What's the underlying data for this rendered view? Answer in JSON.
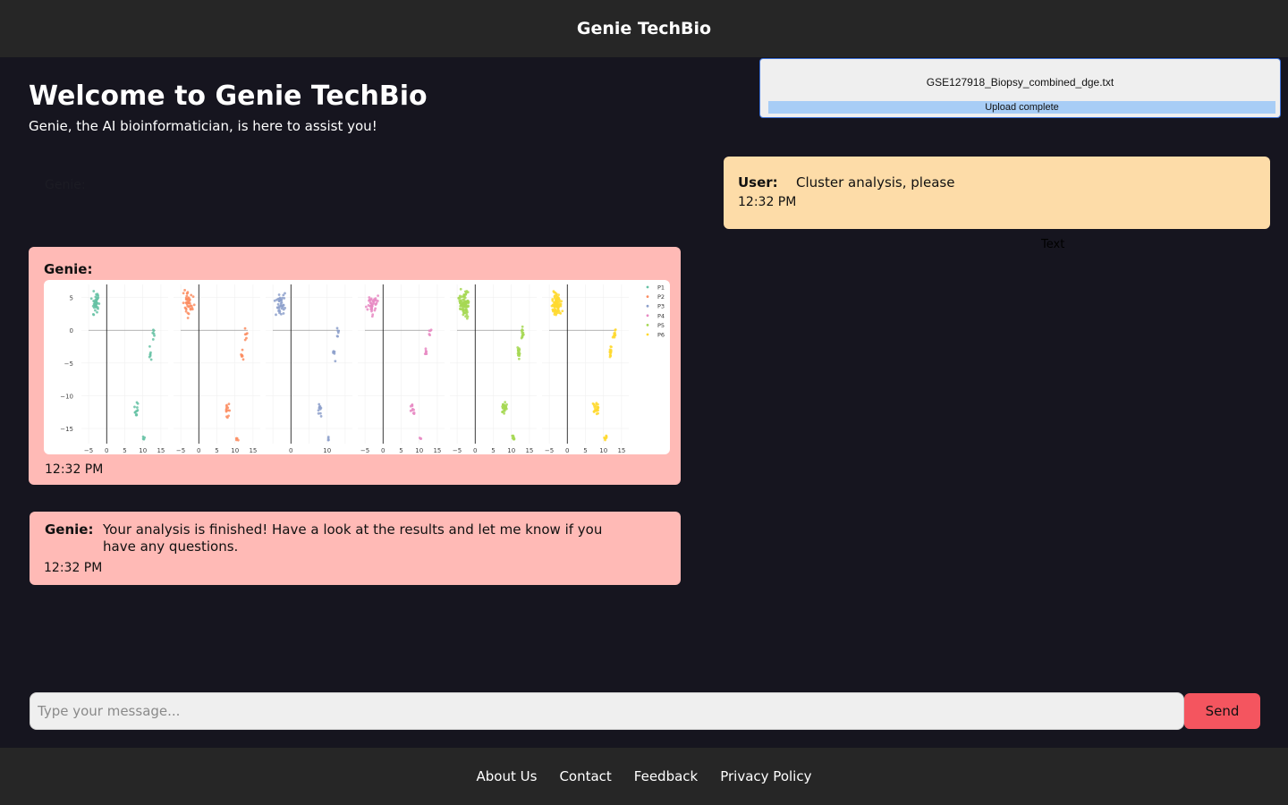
{
  "header": {
    "title": "Genie TechBio"
  },
  "welcome": {
    "title": "Welcome to Genie TechBio",
    "subtitle": "Genie, the AI bioinformatician, is here to assist you!"
  },
  "ghost_labels": {
    "genie": "Genie:",
    "text": "Text"
  },
  "upload": {
    "filename": "GSE127918_Biopsy_combined_dge.txt",
    "status": "Upload complete",
    "progress": 1.0
  },
  "messages": [
    {
      "sender": "User:",
      "text": "Cluster analysis, please",
      "time": "12:32 PM"
    },
    {
      "sender": "Genie:",
      "time": "12:32 PM"
    },
    {
      "sender": "Genie:",
      "text": "Your analysis is finished! Have a look at the results and let me know if you have any questions.",
      "time": "12:32 PM"
    }
  ],
  "input": {
    "placeholder": "Type your message...",
    "value": ""
  },
  "send_label": "Send",
  "footer": {
    "links": [
      "About Us",
      "Contact",
      "Feedback",
      "Privacy Policy"
    ]
  },
  "chart_data": {
    "type": "scatter",
    "panels": [
      "P1",
      "P2",
      "P3",
      "P4",
      "P5",
      "P6"
    ],
    "legend": [
      "P1",
      "P2",
      "P3",
      "P4",
      "P5",
      "P6"
    ],
    "legend_position": "top-right",
    "colors": [
      "#66c2a5",
      "#fc8d62",
      "#8da0cb",
      "#e78ac3",
      "#a6d854",
      "#ffd92f"
    ],
    "ylim": [
      -18,
      7
    ],
    "yticks": [
      "5",
      "0",
      "−5",
      "−10",
      "−15"
    ],
    "xlim": [
      -7,
      17
    ],
    "panel_xticks": [
      [
        "−5",
        "0",
        "5",
        "10",
        "15"
      ],
      [
        "−5",
        "0",
        "5",
        "10",
        "15"
      ],
      [
        "0",
        "10"
      ],
      [
        "−5",
        "0",
        "5",
        "10",
        "15"
      ],
      [
        "−5",
        "0",
        "5",
        "10",
        "15"
      ],
      [
        "−5",
        "0",
        "5",
        "10",
        "15"
      ]
    ],
    "clusters": [
      {
        "x": -3,
        "y": 4,
        "sx": 1.1,
        "sy": 1.5
      },
      {
        "x": 12,
        "y": -3.5,
        "sx": 0.3,
        "sy": 0.8
      },
      {
        "x": 8,
        "y": -12,
        "sx": 0.6,
        "sy": 0.8
      },
      {
        "x": 10.5,
        "y": -16.5,
        "sx": 0.3,
        "sy": 0.3
      },
      {
        "x": 13,
        "y": -0.5,
        "sx": 0.3,
        "sy": 0.8
      }
    ],
    "points_per_panel": [
      70,
      75,
      70,
      65,
      160,
      150
    ]
  }
}
